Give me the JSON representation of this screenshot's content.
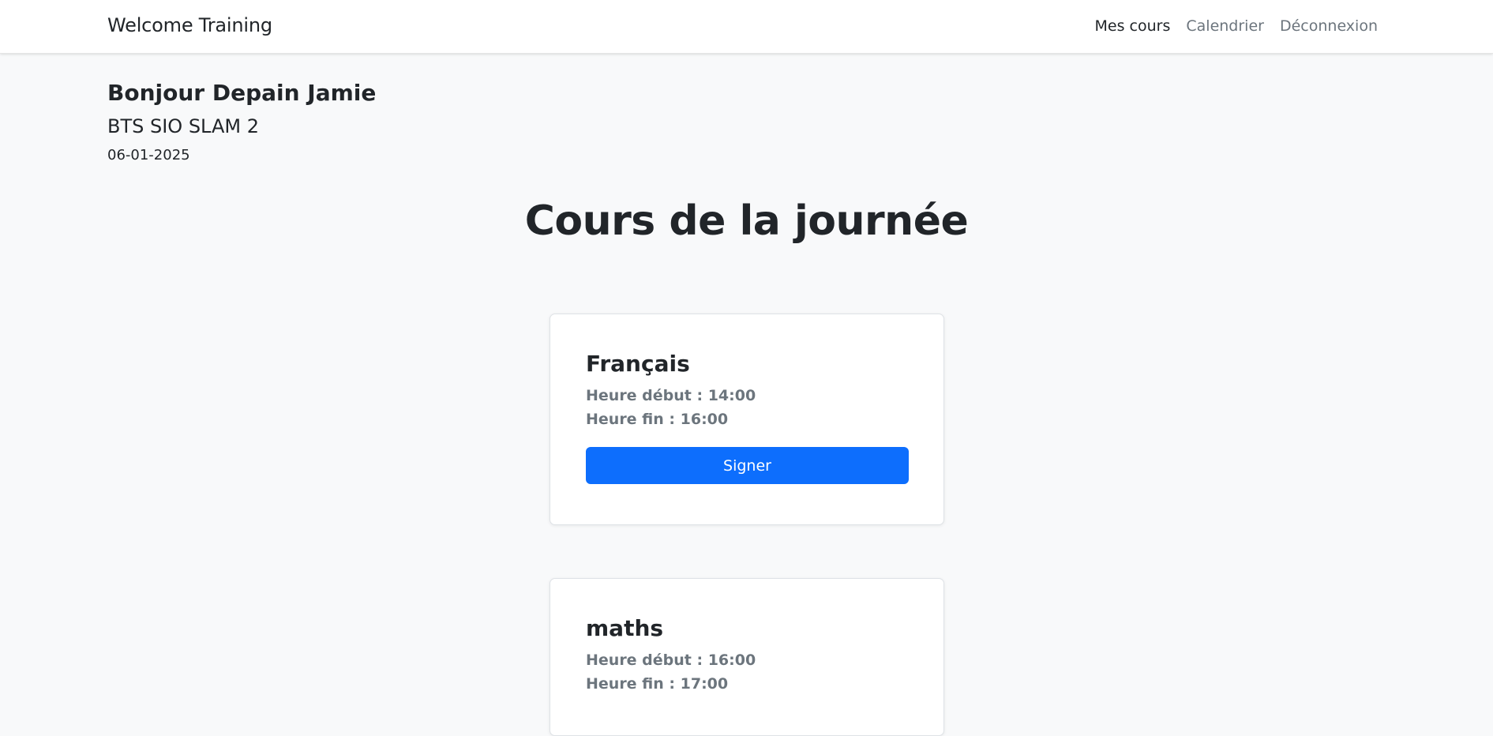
{
  "navbar": {
    "brand": "Welcome Training",
    "links": [
      {
        "label": "Mes cours",
        "active": true
      },
      {
        "label": "Calendrier",
        "active": false
      },
      {
        "label": "Déconnexion",
        "active": false
      }
    ]
  },
  "user": {
    "greeting": "Bonjour Depain Jamie",
    "class_name": "BTS SIO SLAM 2",
    "date": "06-01-2025"
  },
  "main": {
    "title": "Cours de la journée",
    "courses": [
      {
        "name": "Français",
        "start": "Heure début : 14:00",
        "end": "Heure fin : 16:00",
        "button_label": "Signer"
      },
      {
        "name": "maths",
        "start": "Heure début : 16:00",
        "end": "Heure fin : 17:00"
      }
    ]
  },
  "colors": {
    "primary": "#0d6efd",
    "background": "#f8f9fa",
    "muted_text": "#6c757d",
    "text": "#212529"
  }
}
